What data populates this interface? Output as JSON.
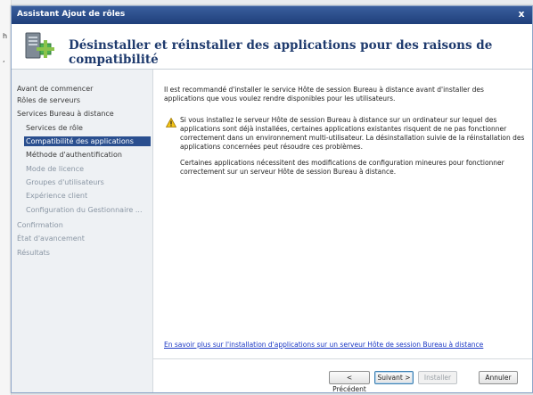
{
  "window": {
    "title": "Assistant Ajout de rôles",
    "close_glyph": "x"
  },
  "header": {
    "heading": "Désinstaller et réinstaller des applications pour des raisons de compatibilité",
    "icon": "server-roles-icon"
  },
  "sidebar": {
    "items": [
      {
        "label": "Avant de commencer",
        "state": "normal"
      },
      {
        "label": "Rôles de serveurs",
        "state": "normal"
      },
      {
        "label": "Services Bureau à distance",
        "state": "normal"
      },
      {
        "label": "Services de rôle",
        "state": "normal"
      },
      {
        "label": "Compatibilité des applications",
        "state": "selected"
      },
      {
        "label": "Méthode d'authentification",
        "state": "normal"
      },
      {
        "label": "Mode de licence",
        "state": "disabled"
      },
      {
        "label": "Groupes d'utilisateurs",
        "state": "disabled"
      },
      {
        "label": "Expérience client",
        "state": "disabled"
      },
      {
        "label": "Configuration du Gestionnaire ...",
        "state": "disabled"
      },
      {
        "label": "Confirmation",
        "state": "disabled"
      },
      {
        "label": "État d'avancement",
        "state": "disabled"
      },
      {
        "label": "Résultats",
        "state": "disabled"
      }
    ]
  },
  "content": {
    "intro": "Il est recommandé d'installer le service Hôte de session Bureau à distance avant d'installer des applications que vous voulez rendre disponibles pour les utilisateurs.",
    "warning": "Si vous installez le serveur Hôte de session Bureau à distance sur un ordinateur sur lequel des applications sont déjà installées, certaines applications existantes risquent de ne pas fonctionner correctement dans un environnement multi-utilisateur. La désinstallation suivie de la réinstallation des applications concernées peut résoudre ces problèmes.",
    "extra": "Certaines applications nécessitent des modifications de configuration mineures pour fonctionner correctement sur un serveur Hôte de session Bureau à distance.",
    "more_link": "En savoir plus sur l'installation d'applications sur un serveur Hôte de session Bureau à distance"
  },
  "buttons": {
    "previous": "< Précédent",
    "next": "Suivant >",
    "install": "Installer",
    "cancel": "Annuler"
  }
}
